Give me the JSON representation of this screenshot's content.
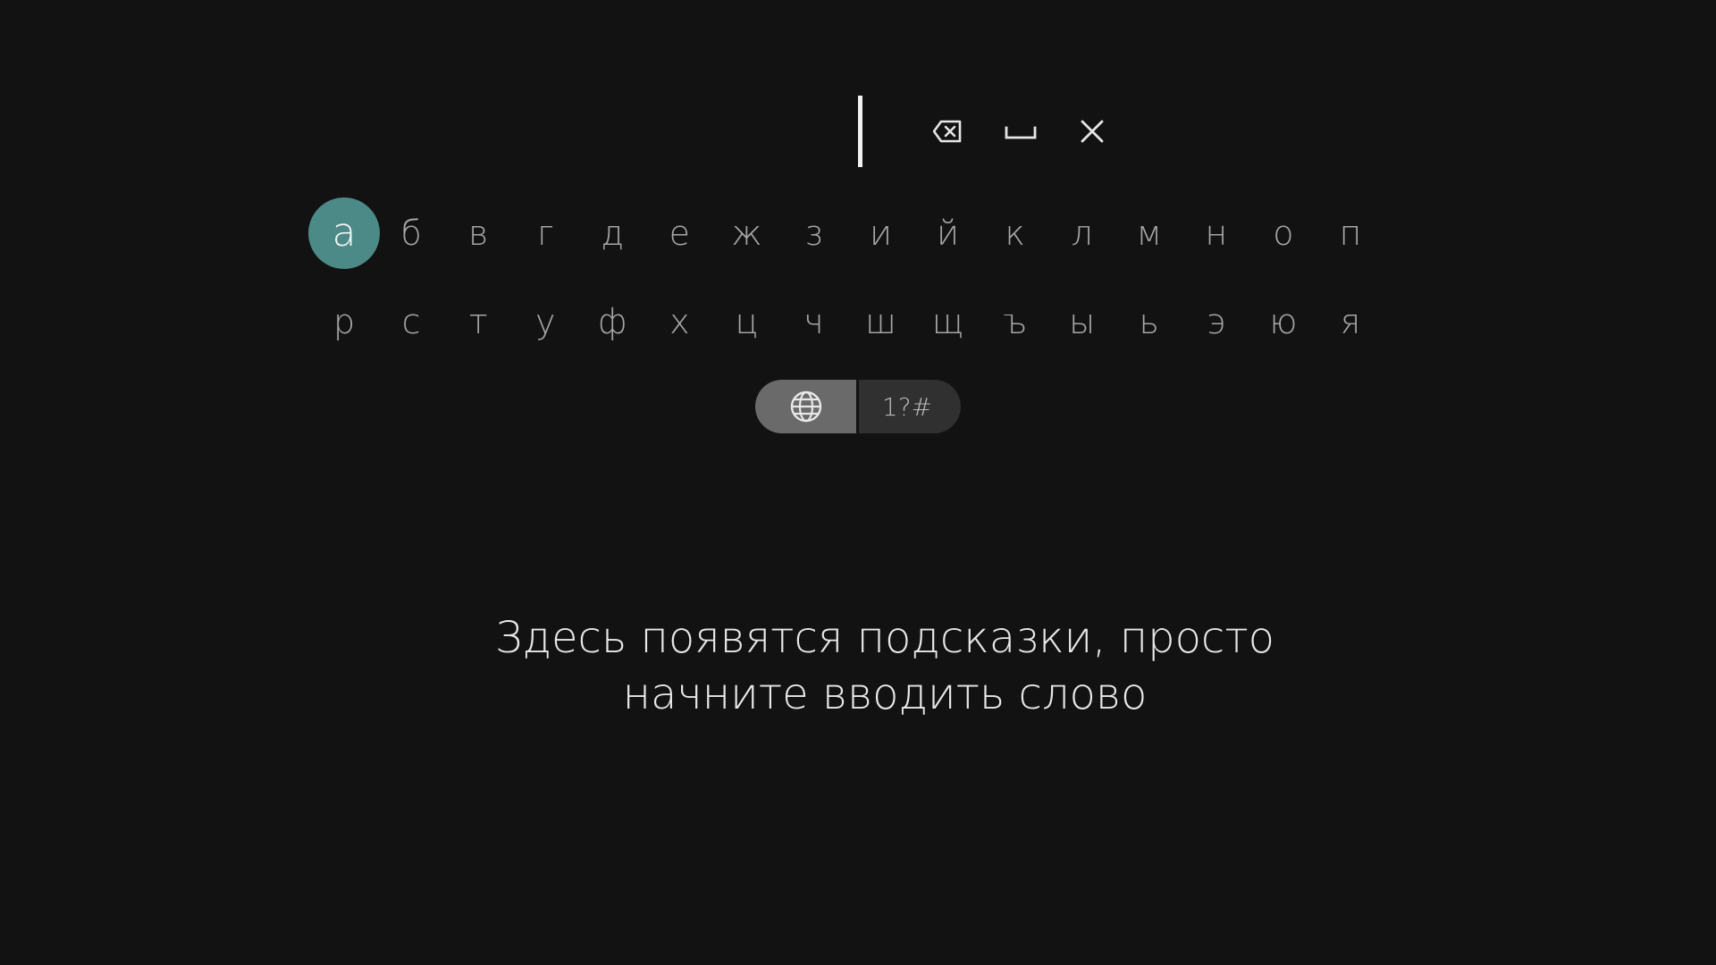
{
  "input": {
    "value": ""
  },
  "controls": {
    "backspace_icon": "backspace-icon",
    "space_icon": "space-bar-icon",
    "close_icon": "close-icon"
  },
  "keyboard": {
    "active_key": "а",
    "row1": [
      "а",
      "б",
      "в",
      "г",
      "д",
      "е",
      "ж",
      "з",
      "и",
      "й",
      "к",
      "л",
      "м",
      "н",
      "о",
      "п"
    ],
    "row2": [
      "р",
      "с",
      "т",
      "у",
      "ф",
      "х",
      "ц",
      "ч",
      "ш",
      "щ",
      "ъ",
      "ы",
      "ь",
      "э",
      "ю",
      "я"
    ],
    "language_icon": "globe-icon",
    "symbols_label": "1?#"
  },
  "hint": {
    "line1": "Здесь появятся подсказки, просто",
    "line2": "начните вводить слово"
  },
  "colors": {
    "background": "#121212",
    "accent": "#4c8a87",
    "key_text": "#a6a6a6"
  }
}
